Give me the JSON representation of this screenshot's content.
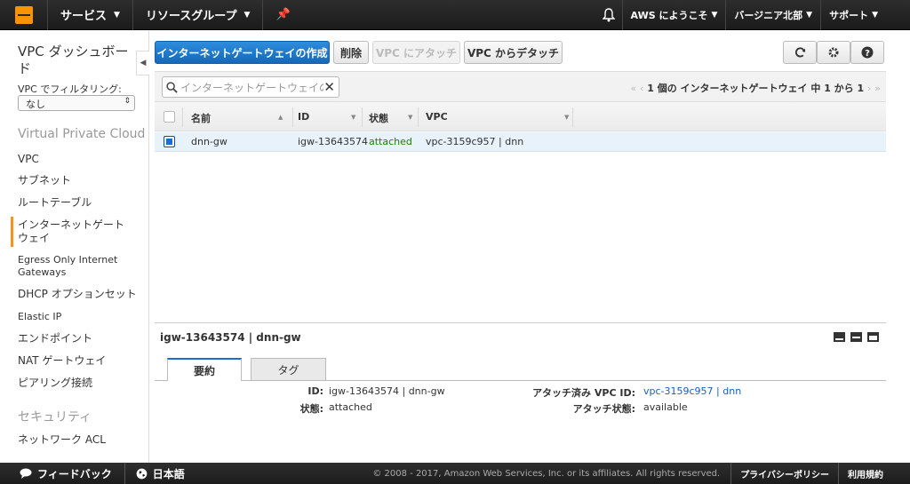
{
  "topnav": {
    "services": "サービス",
    "resource_groups": "リソースグループ",
    "pin": "✦",
    "welcome": "AWS にようこそ",
    "region": "バージニア北部",
    "support": "サポート"
  },
  "sidebar": {
    "dashboard": "VPC ダッシュボード",
    "filter_label": "VPC でフィルタリング:",
    "filter_value": "なし",
    "section_vpc": "Virtual Private Cloud",
    "items": [
      "VPC",
      "サブネット",
      "ルートテーブル",
      "インターネットゲートウェイ",
      "Egress Only Internet Gateways",
      "DHCP オプションセット",
      "Elastic IP",
      "エンドポイント",
      "NAT ゲートウェイ",
      "ピアリング接続"
    ],
    "section_security": "セキュリティ",
    "security_items": [
      "ネットワーク ACL"
    ]
  },
  "toolbar": {
    "create": "インターネットゲートウェイの作成",
    "delete": "削除",
    "attach": "VPC にアタッチ",
    "detach": "VPC からデタッチ"
  },
  "grid": {
    "search_placeholder": "インターネットゲートウェイの検索",
    "pager": "1 個の インターネットゲートウェイ 中 1 から 1",
    "columns": [
      "名前",
      "ID",
      "状態",
      "VPC"
    ],
    "rows": [
      {
        "name": "dnn-gw",
        "id": "igw-13643574",
        "state": "attached",
        "vpc": "vpc-3159c957 | dnn"
      }
    ]
  },
  "detail": {
    "title": "igw-13643574 | dnn-gw",
    "tabs": [
      "要約",
      "タグ"
    ],
    "id_label": "ID:",
    "id_value": "igw-13643574 | dnn-gw",
    "state_label": "状態:",
    "state_value": "attached",
    "vpcid_label": "アタッチ済み VPC ID:",
    "vpcid_value": "vpc-3159c957 | dnn",
    "attach_state_label": "アタッチ状態:",
    "attach_state_value": "available"
  },
  "footer": {
    "feedback": "フィードバック",
    "language": "日本語",
    "copyright": "© 2008 - 2017, Amazon Web Services, Inc. or its affiliates. All rights reserved.",
    "privacy": "プライバシーポリシー",
    "terms": "利用規約"
  },
  "colors": {
    "accent": "#1a6ed1",
    "orange": "#f7941d",
    "green": "#1d8102"
  }
}
